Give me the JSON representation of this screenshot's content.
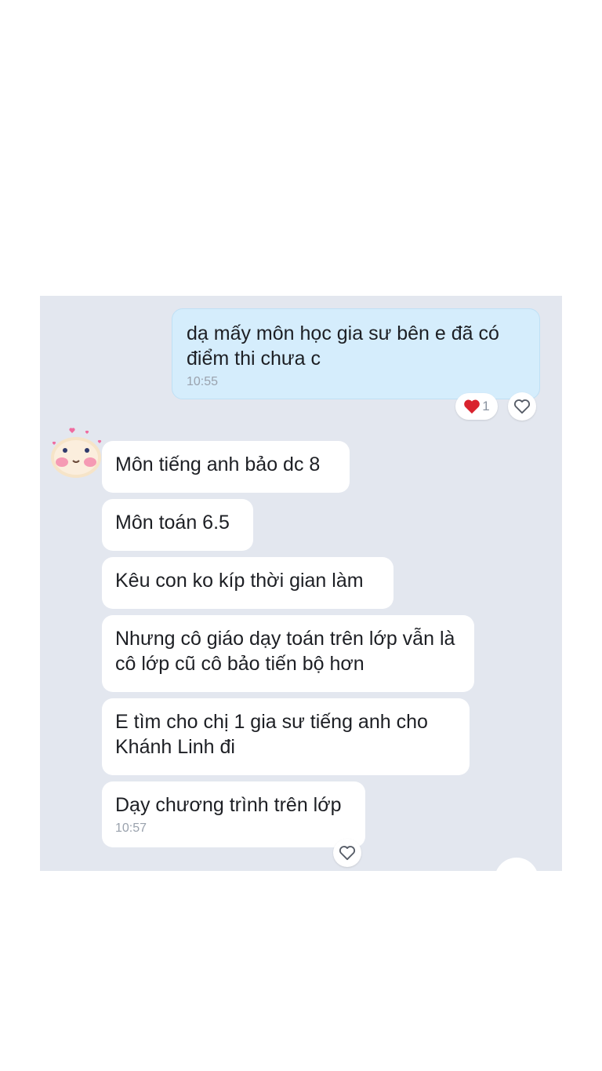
{
  "messages": {
    "outgoing": {
      "text": "dạ mấy môn học gia sư bên e đã có điểm thi chưa c",
      "time": "10:55",
      "reaction_count": "1",
      "reaction_icon": "heart-icon"
    },
    "incoming": [
      {
        "text": "Môn tiếng anh bảo dc 8"
      },
      {
        "text": "Môn toán 6.5"
      },
      {
        "text": "Kêu con ko kíp thời gian làm"
      },
      {
        "text": "Nhưng cô giáo dạy toán trên lớp vẫn là cô lớp cũ cô bảo tiến bộ hơn"
      },
      {
        "text": "E tìm cho chị 1 gia sư tiếng anh cho Khánh Linh đi"
      },
      {
        "text": "Dạy chương trình trên lớp",
        "time": "10:57"
      }
    ]
  },
  "colors": {
    "panel_bg": "#e3e7ef",
    "outgoing_bubble": "#d5edfc",
    "incoming_bubble": "#ffffff",
    "heart": "#d9232e"
  }
}
